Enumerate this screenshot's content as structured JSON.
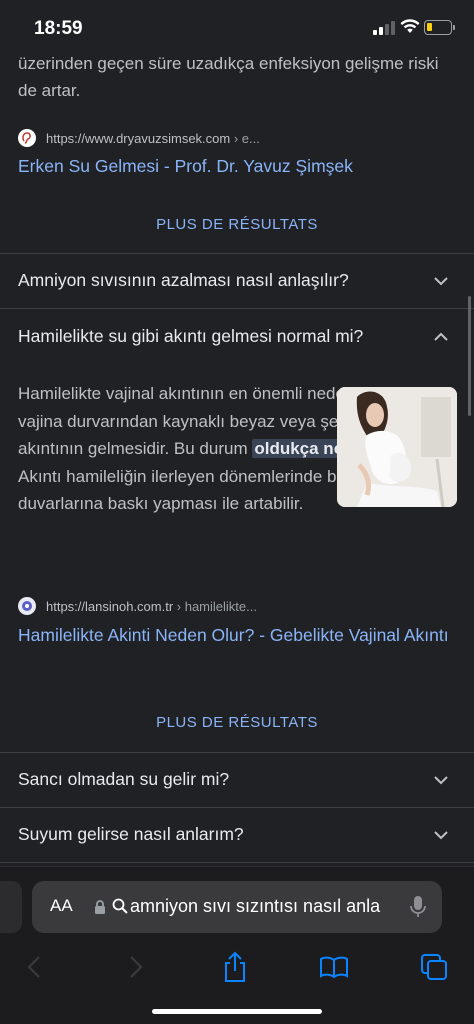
{
  "status_bar": {
    "time": "18:59",
    "battery_level": 0.15
  },
  "top_snippet": {
    "text": "üzerinden geçen süre uzadıkça enfeksiyon gelişme riski de artar.",
    "source_url": "https://www.dryavuzsimsek.com",
    "source_crumb": " › e...",
    "link_title": "Erken Su Gelmesi - Prof. Dr. Yavuz Şimşek"
  },
  "plus_results_label": "PLUS DE RÉSULTATS",
  "faq": [
    {
      "question": "Amniyon sıvısının azalması nasıl anlaşılır?",
      "expanded": false
    },
    {
      "question": "Hamilelikte su gibi akıntı gelmesi normal mi?",
      "expanded": true
    }
  ],
  "expanded_answer": {
    "text_before": "Hamilelikte vajinal akıntının en önemli nedeni genişleyen vajina durvarından kaynaklı beyaz veya şeffaf bir akıntının gelmesidir. Bu durum ",
    "highlight": "oldukça normaldir",
    "text_after": ". Akıntı hamileliğin ilerleyen dönemlerinde bebeğin vajina duvarlarına baskı yapması ile artabilir.",
    "source_url": "https://lansinoh.com.tr",
    "source_crumb": " › hamilelikte...",
    "link_title": "Hamilelikte Akinti Neden Olur? - Gebelikte Vajinal Akıntı"
  },
  "plus_results_label_2": "PLUS DE RÉSULTATS",
  "faq_more": [
    {
      "question": "Sancı olmadan su gelir mi?",
      "expanded": false
    },
    {
      "question": "Suyum gelirse nasıl anlarım?",
      "expanded": false
    }
  ],
  "browser": {
    "aa_label": "AA",
    "address_text": "amniyon sıvı sızıntısı nasıl anla"
  },
  "colors": {
    "background": "#202124",
    "link": "#8ab4f8",
    "text": "#bdc1c6",
    "heading": "#e8eaed",
    "ios_blue": "#0a84ff"
  }
}
